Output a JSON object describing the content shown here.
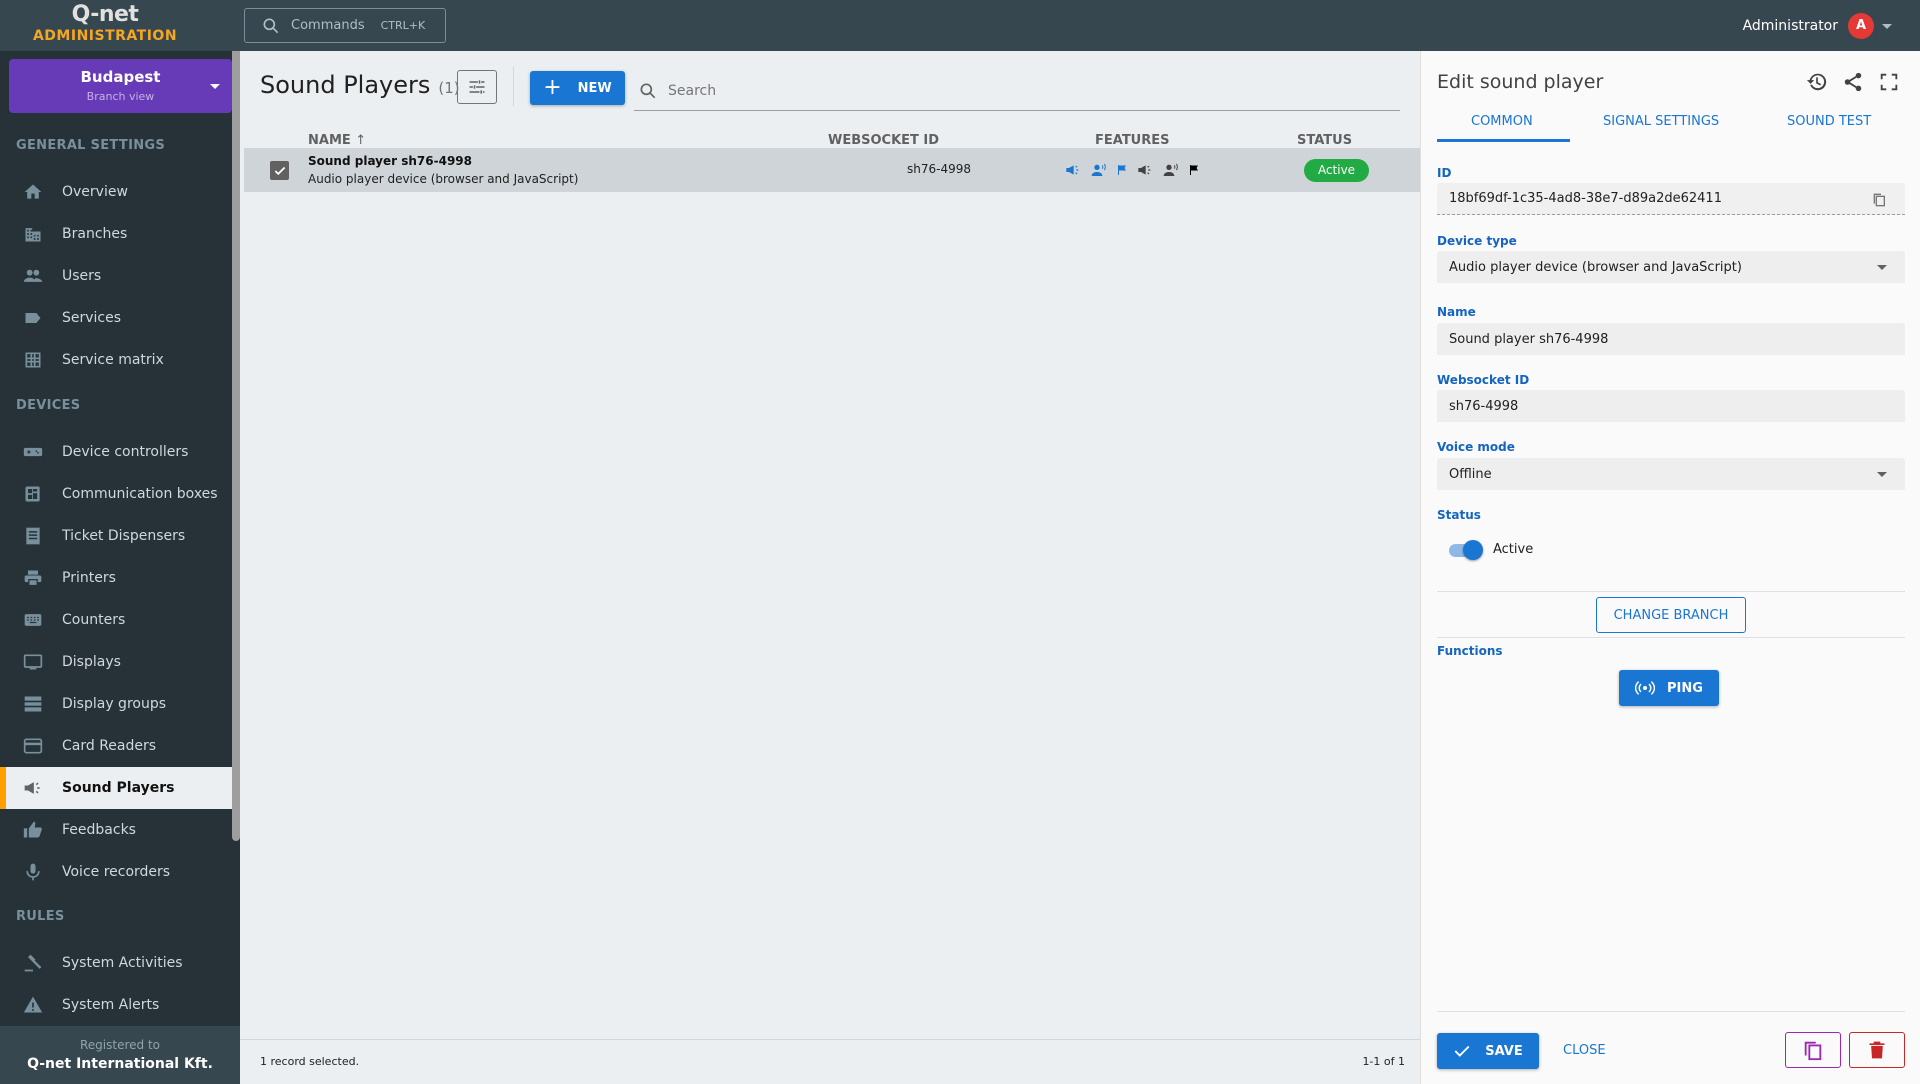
{
  "app": {
    "logo": "Q-net",
    "logo_sub": "ADMINISTRATION",
    "commands_label": "Commands",
    "commands_shortcut": "CTRL+K",
    "user_name": "Administrator",
    "user_initial": "A"
  },
  "branch": {
    "name": "Budapest",
    "sub": "Branch view"
  },
  "sidebar": {
    "sections": [
      {
        "title": "GENERAL SETTINGS",
        "items": [
          {
            "label": "Overview",
            "icon": "home-icon"
          },
          {
            "label": "Branches",
            "icon": "building-icon"
          },
          {
            "label": "Users",
            "icon": "users-icon"
          },
          {
            "label": "Services",
            "icon": "label-icon"
          },
          {
            "label": "Service matrix",
            "icon": "grid-icon"
          }
        ]
      },
      {
        "title": "DEVICES",
        "items": [
          {
            "label": "Device controllers",
            "icon": "gamepad-icon"
          },
          {
            "label": "Communication boxes",
            "icon": "chip-icon"
          },
          {
            "label": "Ticket Dispensers",
            "icon": "receipt-icon"
          },
          {
            "label": "Printers",
            "icon": "printer-icon"
          },
          {
            "label": "Counters",
            "icon": "keyboard-icon"
          },
          {
            "label": "Displays",
            "icon": "monitor-icon"
          },
          {
            "label": "Display groups",
            "icon": "stack-icon"
          },
          {
            "label": "Card Readers",
            "icon": "card-icon"
          },
          {
            "label": "Sound Players",
            "icon": "megaphone-icon",
            "active": true
          },
          {
            "label": "Feedbacks",
            "icon": "thumbs-up-icon"
          },
          {
            "label": "Voice recorders",
            "icon": "microphone-icon"
          }
        ]
      },
      {
        "title": "RULES",
        "items": [
          {
            "label": "System Activities",
            "icon": "gavel-icon"
          },
          {
            "label": "System Alerts",
            "icon": "warning-icon"
          }
        ]
      }
    ],
    "registered_label": "Registered to",
    "registered_name": "Q-net International Kft."
  },
  "main": {
    "title": "Sound Players",
    "count": "(1)",
    "new_label": "NEW",
    "search_placeholder": "Search",
    "columns": {
      "name": "NAME",
      "websocket": "WEBSOCKET ID",
      "features": "FEATURES",
      "status": "STATUS"
    },
    "rows": [
      {
        "name": "Sound player sh76-4998",
        "description": "Audio player device (browser and JavaScript)",
        "websocket_id": "sh76-4998",
        "features": [
          "megaphone-blue",
          "voice-blue",
          "flag-blue",
          "megaphone-dark",
          "voice-dark",
          "flag-black"
        ],
        "status": "Active",
        "selected": true
      }
    ],
    "footer_left": "1 record selected.",
    "footer_right": "1-1 of 1"
  },
  "panel": {
    "title": "Edit sound player",
    "tabs": [
      "COMMON",
      "SIGNAL SETTINGS",
      "SOUND TEST"
    ],
    "active_tab": "COMMON",
    "fields": {
      "id_label": "ID",
      "id_value": "18bf69df-1c35-4ad8-38e7-d89a2de62411",
      "device_type_label": "Device type",
      "device_type_value": "Audio player device (browser and JavaScript)",
      "name_label": "Name",
      "name_value": "Sound player sh76-4998",
      "websocket_label": "Websocket ID",
      "websocket_value": "sh76-4998",
      "voice_mode_label": "Voice mode",
      "voice_mode_value": "Offline",
      "status_label": "Status",
      "status_value": "Active",
      "status_on": true
    },
    "change_branch_label": "CHANGE BRANCH",
    "functions_label": "Functions",
    "ping_label": "PING",
    "save_label": "SAVE",
    "close_label": "CLOSE"
  },
  "colors": {
    "accent": "#1976d2",
    "branch": "#673ab7",
    "active_badge": "#22aa44",
    "active_nav_marker": "#ffa000",
    "delete": "#c62828",
    "duplicate": "#9c27b0"
  }
}
